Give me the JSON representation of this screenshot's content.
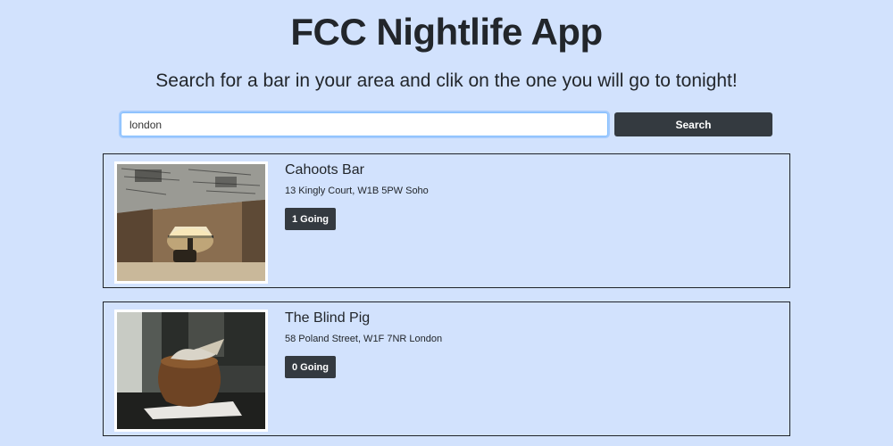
{
  "header": {
    "title": "FCC Nightlife App",
    "subtitle": "Search for a bar in your area and clik on the one you will go to tonight!"
  },
  "search": {
    "value": "london",
    "button_label": "Search"
  },
  "bars": [
    {
      "name": "Cahoots Bar",
      "address": "13 Kingly Court, W1B 5PW Soho",
      "going_label": "1 Going"
    },
    {
      "name": "The Blind Pig",
      "address": "58 Poland Street, W1F 7NR London",
      "going_label": "0 Going"
    }
  ]
}
